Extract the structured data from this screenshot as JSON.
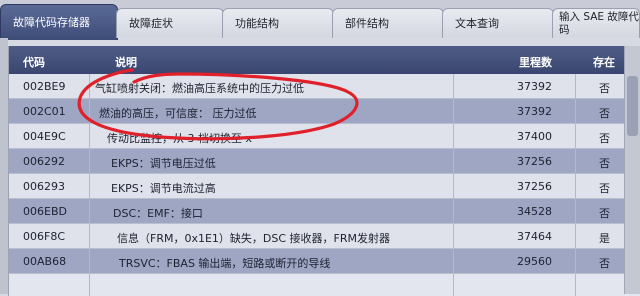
{
  "tabs": [
    {
      "label": "故障代码存储器",
      "active": true
    },
    {
      "label": "故障症状",
      "active": false
    },
    {
      "label": "功能结构",
      "active": false
    },
    {
      "label": "部件结构",
      "active": false
    },
    {
      "label": "文本查询",
      "active": false
    },
    {
      "label": "输入 SAE 故障代码",
      "active": false
    }
  ],
  "table": {
    "headers": {
      "code": "代码",
      "description": "说明",
      "mileage": "里程数",
      "exists": "存在"
    },
    "rows": [
      {
        "code": "002BE9",
        "description": "气缸喷射关闭：燃油高压系统中的压力过低",
        "mileage": "37392",
        "exists": "否"
      },
      {
        "code": "002C01",
        "description": "燃油的高压，可信度： 压力过低",
        "mileage": "37392",
        "exists": "否"
      },
      {
        "code": "004E9C",
        "description": "传动比监控，从 3 档切换至 x",
        "mileage": "37400",
        "exists": "否"
      },
      {
        "code": "006292",
        "description": "EKPS：调节电压过低",
        "mileage": "37256",
        "exists": "否"
      },
      {
        "code": "006293",
        "description": "EKPS：调节电流过高",
        "mileage": "37256",
        "exists": "否"
      },
      {
        "code": "006EBD",
        "description": "DSC：EMF：接口",
        "mileage": "34528",
        "exists": "否"
      },
      {
        "code": "006F8C",
        "description": "信息（FRM，0x1E1）缺失，DSC 接收器，FRM发射器",
        "mileage": "37464",
        "exists": "是"
      },
      {
        "code": "00AB68",
        "description": "TRSVC：FBAS 输出端，短路或断开的导线",
        "mileage": "29560",
        "exists": "否"
      }
    ]
  },
  "colors": {
    "header": "#3e4c78",
    "row_highlight": "#9ea6c4",
    "annotation": "#e0202a"
  }
}
